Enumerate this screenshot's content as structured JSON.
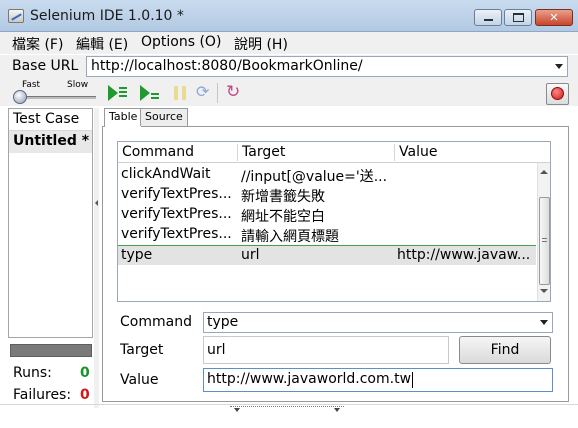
{
  "window": {
    "title": "Selenium IDE 1.0.10 *"
  },
  "menu": {
    "items": [
      {
        "label": "檔案 (F)"
      },
      {
        "label": "編輯 (E)"
      },
      {
        "label": "Options (O)"
      },
      {
        "label": "說明 (H)"
      }
    ]
  },
  "base_url": {
    "label": "Base URL",
    "value": "http://localhost:8080/BookmarkOnline/"
  },
  "toolbar": {
    "speed_fast": "Fast",
    "speed_slow": "Slow"
  },
  "test_case_panel": {
    "header": "Test Case",
    "items": [
      {
        "label": "Untitled *"
      }
    ]
  },
  "stats": {
    "runs_label": "Runs:",
    "runs_value": "0",
    "failures_label": "Failures:",
    "failures_value": "0"
  },
  "tabs": [
    {
      "label": "Table"
    },
    {
      "label": "Source"
    }
  ],
  "table": {
    "columns": [
      "Command",
      "Target",
      "Value"
    ],
    "rows": [
      {
        "command": "clickAndWait",
        "target": "//input[@value='送...",
        "value": ""
      },
      {
        "command": "verifyTextPres...",
        "target": "新增書籤失敗",
        "value": ""
      },
      {
        "command": "verifyTextPres...",
        "target": "網址不能空白",
        "value": ""
      },
      {
        "command": "verifyTextPres...",
        "target": "請輸入網頁標題",
        "value": ""
      },
      {
        "command": "type",
        "target": "url",
        "value": "http://www.javaw..."
      }
    ]
  },
  "form": {
    "command_label": "Command",
    "command_value": "type",
    "target_label": "Target",
    "target_value": "url",
    "find_label": "Find",
    "value_label": "Value",
    "value_value": "http://www.javaworld.com.tw"
  },
  "colors": {
    "runs": "#14942a",
    "failures": "#d01818",
    "play": "#1f9a2c",
    "record": "#d41414"
  },
  "icons": [
    "selenium-app-icon",
    "play-suite-icon",
    "play-test-icon",
    "pause-icon",
    "step-icon",
    "rollup-icon",
    "record-icon"
  ]
}
